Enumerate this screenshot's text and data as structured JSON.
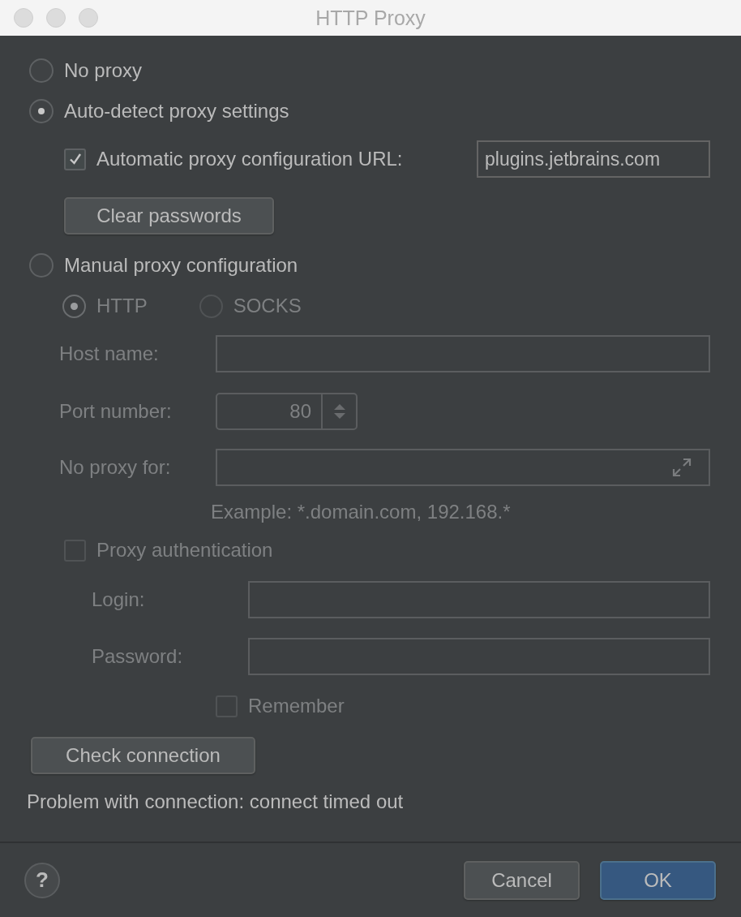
{
  "window": {
    "title": "HTTP Proxy"
  },
  "no_proxy": {
    "label": "No proxy",
    "selected": false
  },
  "auto_detect": {
    "label": "Auto-detect proxy settings",
    "selected": true,
    "pac_url": {
      "label": "Automatic proxy configuration URL:",
      "checked": true,
      "value": "plugins.jetbrains.com"
    },
    "clear_button": "Clear passwords"
  },
  "manual": {
    "label": "Manual proxy configuration",
    "selected": false,
    "disabled": true,
    "types": [
      {
        "label": "HTTP",
        "selected": true
      },
      {
        "label": "SOCKS",
        "selected": false
      }
    ],
    "host": {
      "label": "Host name:"
    },
    "port": {
      "label": "Port number:",
      "value": "80"
    },
    "no_proxy_for": {
      "label": "No proxy for:"
    },
    "example": "Example: *.domain.com, 192.168.*",
    "auth": {
      "label": "Proxy authentication",
      "checked": false,
      "login": {
        "label": "Login:"
      },
      "password": {
        "label": "Password:"
      },
      "remember": {
        "label": "Remember",
        "checked": false
      }
    }
  },
  "check_button": "Check connection",
  "status": "Problem with connection: connect timed out",
  "help": "?",
  "buttons": [
    {
      "label": "Cancel",
      "kind": "secondary"
    },
    {
      "label": "OK",
      "kind": "default"
    }
  ]
}
